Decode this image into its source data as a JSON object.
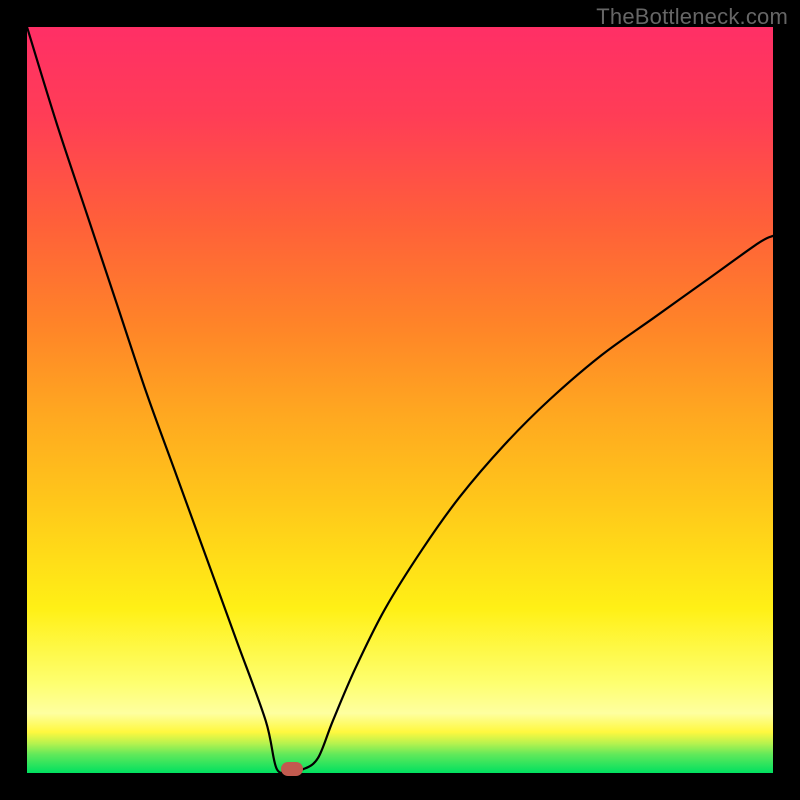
{
  "watermark": "TheBottleneck.com",
  "chart_data": {
    "type": "line",
    "title": "",
    "xlabel": "",
    "ylabel": "",
    "xlim": [
      0,
      1
    ],
    "ylim": [
      0,
      1
    ],
    "series": [
      {
        "name": "curve",
        "x": [
          0.0,
          0.04,
          0.08,
          0.12,
          0.16,
          0.2,
          0.24,
          0.28,
          0.32,
          0.335,
          0.355,
          0.37,
          0.39,
          0.41,
          0.44,
          0.48,
          0.53,
          0.58,
          0.64,
          0.7,
          0.77,
          0.84,
          0.91,
          0.98,
          1.0
        ],
        "y": [
          1.0,
          0.87,
          0.75,
          0.63,
          0.51,
          0.4,
          0.29,
          0.18,
          0.07,
          0.005,
          0.005,
          0.005,
          0.02,
          0.07,
          0.14,
          0.22,
          0.3,
          0.37,
          0.44,
          0.5,
          0.56,
          0.61,
          0.66,
          0.71,
          0.72
        ]
      }
    ],
    "marker": {
      "x": 0.355,
      "y": 0.005,
      "color": "#c25a4f"
    },
    "gradient_stops": [
      {
        "pos": 0.0,
        "color": "#00e060"
      },
      {
        "pos": 0.05,
        "color": "#feffa0"
      },
      {
        "pos": 0.22,
        "color": "#fff016"
      },
      {
        "pos": 0.48,
        "color": "#ffa820"
      },
      {
        "pos": 0.74,
        "color": "#ff5f3a"
      },
      {
        "pos": 1.0,
        "color": "#ff2f66"
      }
    ]
  }
}
